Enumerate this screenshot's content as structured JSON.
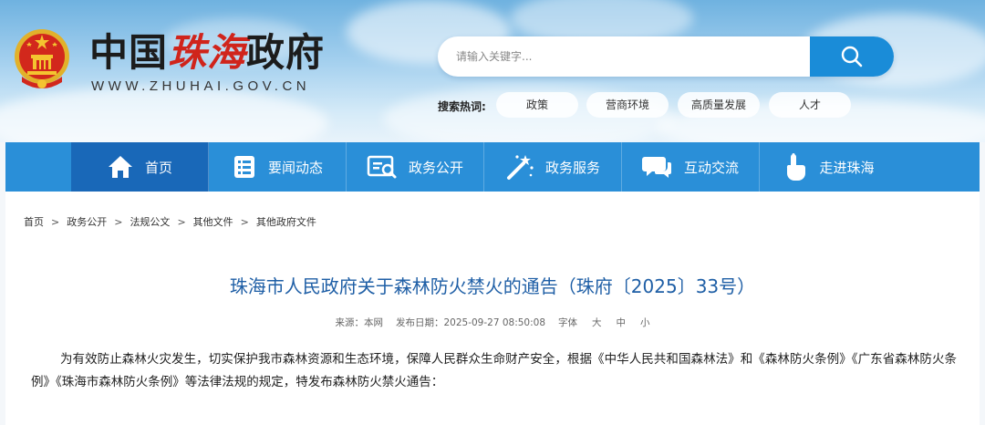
{
  "header": {
    "title_prefix": "中国",
    "title_accent": "珠海",
    "title_suffix": "政府",
    "domain": "WWW.ZHUHAI.GOV.CN",
    "search_placeholder": "请输入关键字...",
    "hot_label": "搜索热词:",
    "hot_tags": [
      "政策",
      "营商环境",
      "高质量发展",
      "人才"
    ]
  },
  "nav": {
    "items": [
      {
        "label": "首页",
        "icon": "home-icon"
      },
      {
        "label": "要闻动态",
        "icon": "news-list-icon"
      },
      {
        "label": "政务公开",
        "icon": "document-search-icon"
      },
      {
        "label": "政务服务",
        "icon": "wand-icon"
      },
      {
        "label": "互动交流",
        "icon": "chat-bubbles-icon"
      },
      {
        "label": "走进珠海",
        "icon": "pointer-hand-icon"
      }
    ]
  },
  "breadcrumb": [
    "首页",
    "政务公开",
    "法规公文",
    "其他文件",
    "其他政府文件"
  ],
  "article": {
    "title": "珠海市人民政府关于森林防火禁火的通告（珠府〔2025〕33号）",
    "source_label": "来源：本网",
    "date_label": "发布日期：2025-09-27 08:50:08",
    "font_label": "字体",
    "font_sizes": [
      "大",
      "中",
      "小"
    ],
    "body": "为有效防止森林火灾发生，切实保护我市森林资源和生态环境，保障人民群众生命财产安全，根据《中华人民共和国森林法》和《森林防火条例》《广东省森林防火条例》《珠海市森林防火条例》等法律法规的规定，特发布森林防火禁火通告："
  },
  "colors": {
    "nav_bg": "#2a8fd8",
    "nav_active": "#1968b8",
    "title_color": "#1f5fa6",
    "accent_red": "#d0241b"
  }
}
